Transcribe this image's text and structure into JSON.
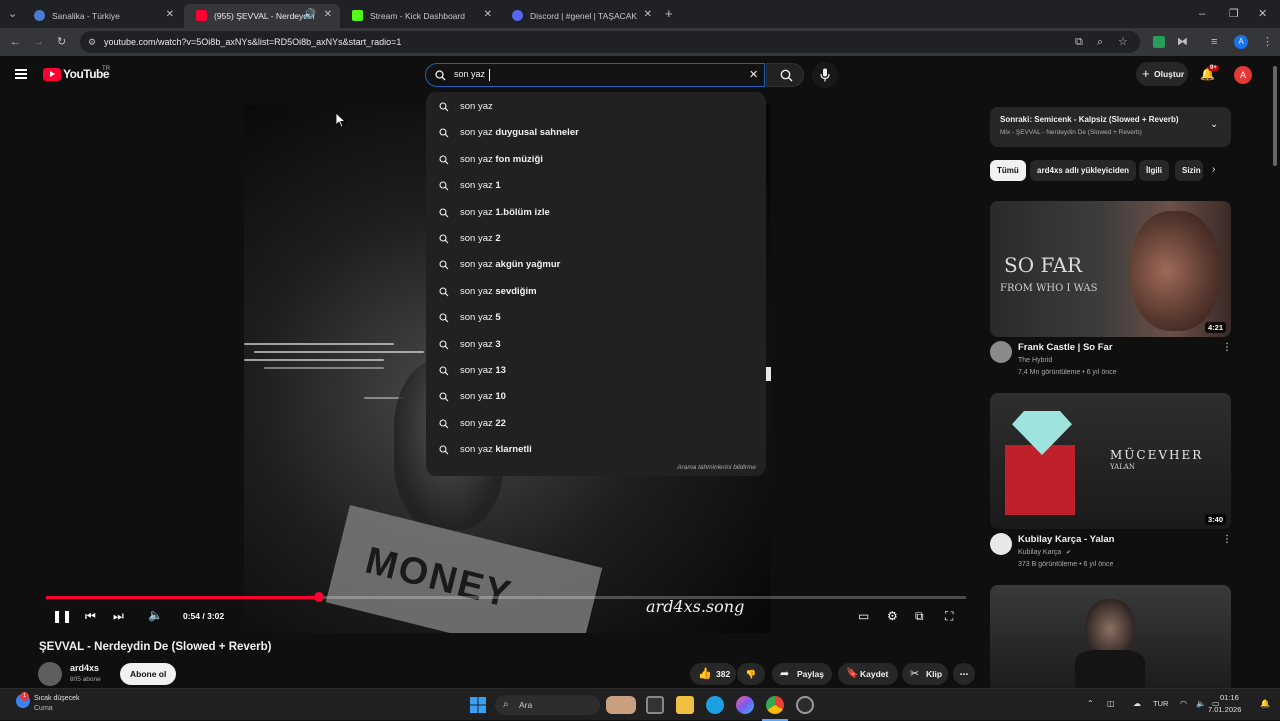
{
  "browser": {
    "tabs": [
      {
        "title": "Sanalika - Türkiye",
        "active": false
      },
      {
        "title": "(955) ŞEVVAL - Nerdeydin De",
        "active": true
      },
      {
        "title": "Stream - Kick Dashboard",
        "active": false
      },
      {
        "title": "Discord | #genel | TAŞACAK BU",
        "active": false
      }
    ],
    "url": "youtube.com/watch?v=5Oi8b_axNYs&list=RD5Oi8b_axNYs&start_radio=1"
  },
  "youtube": {
    "logo_text": "YouTube",
    "region": "TR",
    "search_value": "son yaz",
    "create_label": "Oluştur",
    "notif_count": "9+",
    "avatar_letter": "A",
    "suggestions_footer": "Arama tahminlerini bildirme",
    "suggestions": [
      {
        "prefix": "son yaz",
        "bold": ""
      },
      {
        "prefix": "son yaz",
        "bold": " duygusal sahneler"
      },
      {
        "prefix": "son yaz",
        "bold": " fon müziği"
      },
      {
        "prefix": "son yaz",
        "bold": " 1"
      },
      {
        "prefix": "son yaz",
        "bold": " 1.bölüm izle"
      },
      {
        "prefix": "son yaz",
        "bold": " 2"
      },
      {
        "prefix": "son yaz",
        "bold": " akgün yağmur"
      },
      {
        "prefix": "son yaz",
        "bold": " sevdiğim"
      },
      {
        "prefix": "son yaz",
        "bold": " 5"
      },
      {
        "prefix": "son yaz",
        "bold": " 3"
      },
      {
        "prefix": "son yaz",
        "bold": " 13"
      },
      {
        "prefix": "son yaz",
        "bold": " 10"
      },
      {
        "prefix": "son yaz",
        "bold": " 22"
      },
      {
        "prefix": "son yaz",
        "bold": " klarnetli"
      }
    ]
  },
  "player": {
    "time": "0:54 / 3:02",
    "progress_fraction": 0.297,
    "watermark": "ard4xs.song",
    "overlay_text": "MONEY"
  },
  "video": {
    "title": "ŞEVVAL - Nerdeydin De (Slowed + Reverb)",
    "channel": "ard4xs",
    "subscribers": "805 abone",
    "subscribe_label": "Abone ol",
    "likes": "382",
    "share_label": "Paylaş",
    "save_label": "Kaydet",
    "clip_label": "Klip"
  },
  "sidebar": {
    "next_title": "Sonraki: Semicenk - Kalpsiz (Slowed + Reverb)",
    "next_sub": "Mix - ŞEVVAL - Nerdeydin De (Slowed + Reverb)",
    "chips": [
      "Tümü",
      "ard4xs adlı yükleyiciden",
      "İlgili",
      "Sizin"
    ],
    "videos": [
      {
        "title": "Frank Castle | So Far",
        "channel": "The Hybrid",
        "meta": "7,4 Mn görüntüleme • 6 yıl önce",
        "duration": "4:21",
        "thumb_line1": "SO FAR",
        "thumb_line2": "FROM WHO I WAS"
      },
      {
        "title": "Kubilay Karça - Yalan",
        "channel": "Kubilay Karça",
        "meta": "373 B görüntüleme • 6 yıl önce",
        "duration": "3:40",
        "thumb_line1": "MÜCEVHER",
        "thumb_line2": "YALAN"
      }
    ]
  },
  "taskbar": {
    "weather_line1": "Sıcak düşecek",
    "weather_line2": "Cuma",
    "search_label": "Ara",
    "lang": "TUR",
    "time": "01:16",
    "date": "7.01.2026"
  },
  "colors": {
    "accent": "#ff0033",
    "search_border": "#1c62b9",
    "bg": "#0f0f0f"
  }
}
